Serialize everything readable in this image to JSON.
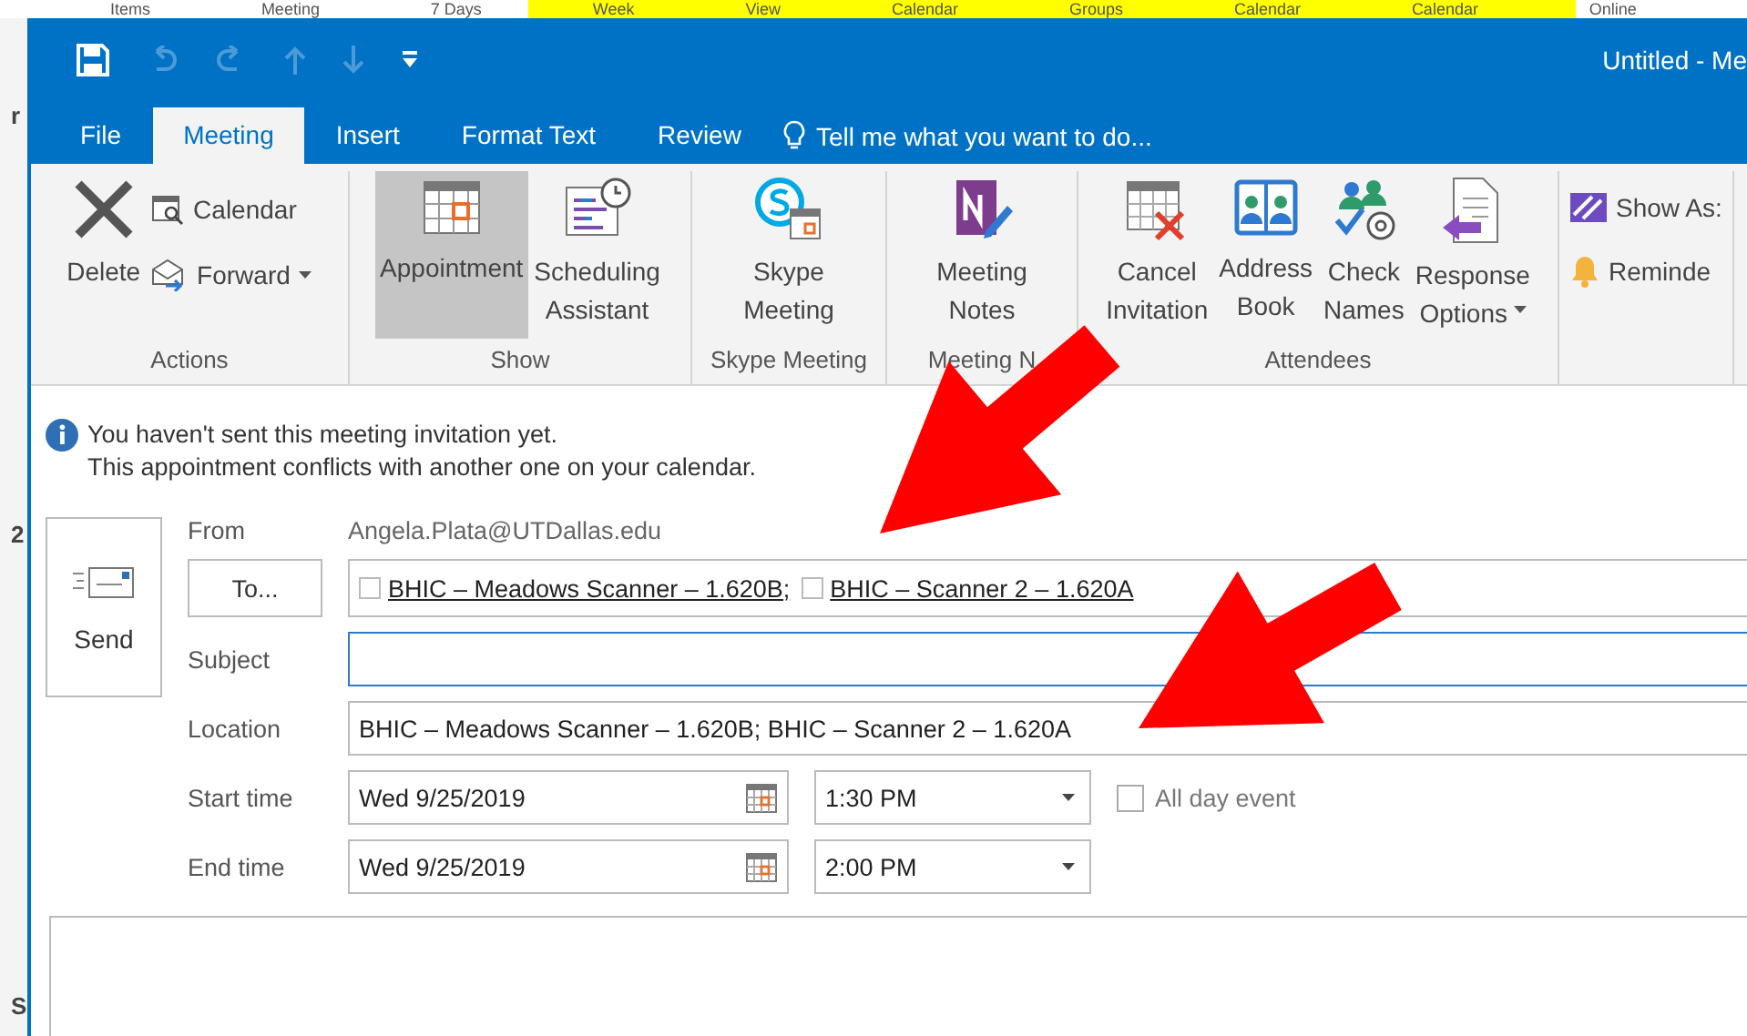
{
  "background_window": {
    "toolbar_labels": [
      "Items",
      "Meeting",
      "7 Days",
      "Week",
      "View",
      "Calendar",
      "Groups",
      "Calendar",
      "Calendar",
      "Online"
    ],
    "side_letters": [
      "r",
      "2",
      "S"
    ]
  },
  "window": {
    "title": "Untitled - Me"
  },
  "quick_access": [
    {
      "kind": "save",
      "disabled": false
    },
    {
      "kind": "undo",
      "disabled": true
    },
    {
      "kind": "redo",
      "disabled": true
    },
    {
      "kind": "up",
      "disabled": true
    },
    {
      "kind": "down",
      "disabled": true
    },
    {
      "kind": "customize",
      "disabled": false
    }
  ],
  "tabs": [
    {
      "label": "File",
      "selected": false
    },
    {
      "label": "Meeting",
      "selected": true
    },
    {
      "label": "Insert",
      "selected": false
    },
    {
      "label": "Format Text",
      "selected": false
    },
    {
      "label": "Review",
      "selected": false
    }
  ],
  "tell_me": "Tell me what you want to do...",
  "ribbon": {
    "groups": [
      {
        "label": "Actions",
        "large": [
          {
            "kind": "delete",
            "lines": [
              "Delete"
            ],
            "selected": false
          }
        ],
        "small": [
          {
            "kind": "calendar",
            "label": "Calendar"
          },
          {
            "kind": "forward",
            "label": "Forward",
            "dropdown": true
          }
        ]
      },
      {
        "label": "Show",
        "large": [
          {
            "kind": "appointment",
            "lines": [
              "Appointment"
            ],
            "selected": true
          },
          {
            "kind": "scheduling",
            "lines": [
              "Scheduling",
              "Assistant"
            ],
            "selected": false
          }
        ]
      },
      {
        "label": "Skype Meeting",
        "large": [
          {
            "kind": "skype",
            "lines": [
              "Skype",
              "Meeting"
            ],
            "selected": false
          }
        ]
      },
      {
        "label": "Meeting N",
        "large": [
          {
            "kind": "notes",
            "lines": [
              "Meeting",
              "Notes"
            ],
            "selected": false
          }
        ]
      },
      {
        "label": "Attendees",
        "large": [
          {
            "kind": "cancel",
            "lines": [
              "Cancel",
              "Invitation"
            ],
            "selected": false
          },
          {
            "kind": "address",
            "lines": [
              "Address",
              "Book"
            ],
            "selected": false
          },
          {
            "kind": "check",
            "lines": [
              "Check",
              "Names"
            ],
            "selected": false
          },
          {
            "kind": "response",
            "lines": [
              "Response",
              "Options"
            ],
            "selected": false,
            "dropdown": true
          }
        ]
      },
      {
        "small": [
          {
            "kind": "showas",
            "label": "Show As:"
          },
          {
            "kind": "bell",
            "label": "Reminde"
          }
        ]
      }
    ]
  },
  "info": [
    "You haven't sent this meeting invitation yet.",
    "This appointment conflicts with another one on your calendar."
  ],
  "send": "Send",
  "from": {
    "label": "From",
    "value": "Angela.Plata@UTDallas.edu"
  },
  "to": {
    "button": "To...",
    "recipients": [
      "BHIC – Meadows Scanner – 1.620B;",
      "BHIC – Scanner 2 – 1.620A"
    ]
  },
  "subject": {
    "label": "Subject",
    "focused": true
  },
  "location": {
    "label": "Location",
    "value": "BHIC – Meadows Scanner – 1.620B; BHIC – Scanner 2 – 1.620A"
  },
  "start": {
    "label": "Start time",
    "date": "Wed 9/25/2019",
    "time": "1:30 PM"
  },
  "all_day": {
    "label": "All day event",
    "checked": false
  },
  "end": {
    "label": "End time",
    "date": "Wed 9/25/2019",
    "time": "2:00 PM"
  }
}
